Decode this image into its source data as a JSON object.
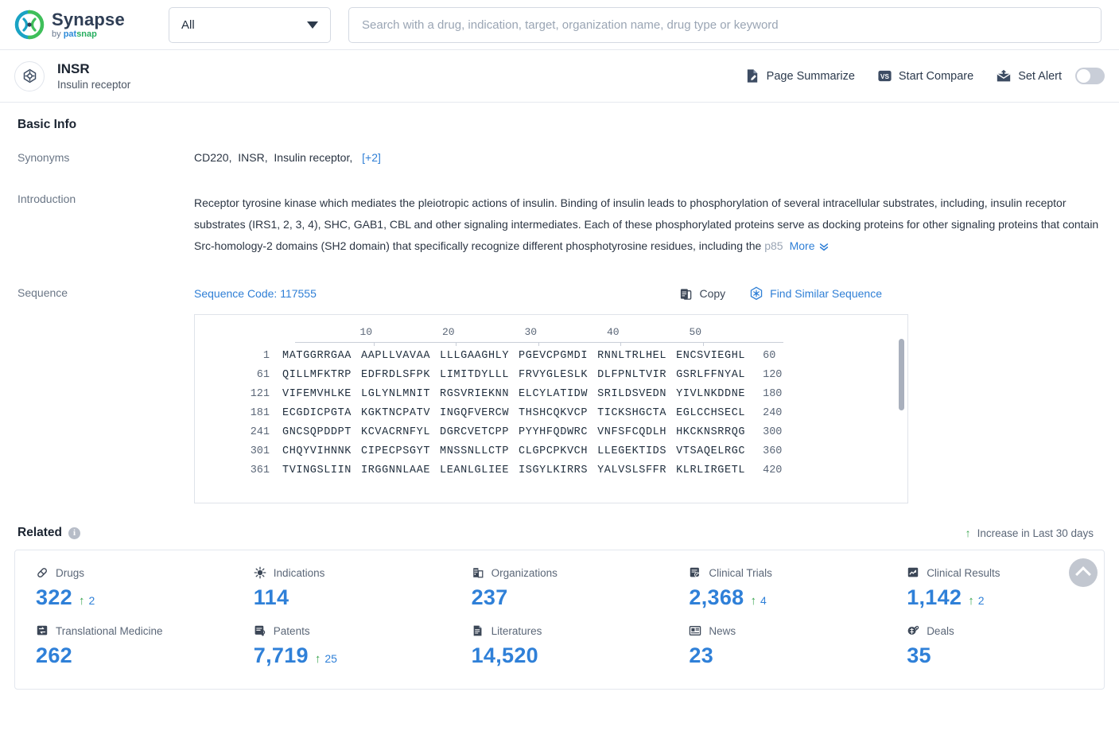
{
  "brand": {
    "name": "Synapse",
    "byline_prefix": "by ",
    "byline_pat": "pat",
    "byline_snap": "snap",
    "logo_icon": "synapse-logo-icon"
  },
  "search": {
    "scope_value": "All",
    "scope_caret_icon": "chevron-down-icon",
    "placeholder": "Search with a drug, indication, target, organization name, drug type or keyword",
    "value": ""
  },
  "entity": {
    "icon": "target-icon",
    "title": "INSR",
    "subtitle": "Insulin receptor",
    "actions": [
      {
        "label": "Page Summarize",
        "icon": "page-summarize-icon"
      },
      {
        "label": "Start Compare",
        "icon": "vs-compare-icon"
      },
      {
        "label": "Set Alert",
        "icon": "alert-mail-icon",
        "toggle": "off"
      }
    ]
  },
  "basic_info": {
    "section_title": "Basic Info",
    "synonyms_label": "Synonyms",
    "synonyms": [
      "CD220",
      "INSR",
      "Insulin receptor"
    ],
    "synonyms_more": "[+2]",
    "introduction_label": "Introduction",
    "introduction": "Receptor tyrosine kinase which mediates the pleiotropic actions of insulin. Binding of insulin leads to phosphorylation of several intracellular substrates, including, insulin receptor substrates (IRS1, 2, 3, 4), SHC, GAB1, CBL and other signaling intermediates. Each of these phosphorylated proteins serve as docking proteins for other signaling proteins that contain Src-homology-2 domains (SH2 domain) that specifically recognize different phosphotyrosine residues, including the ",
    "introduction_tail": "p85",
    "more_label": "More",
    "more_icon": "chevron-double-down-icon"
  },
  "sequence": {
    "label": "Sequence",
    "code_label": "Sequence Code: 117555",
    "copy_label": "Copy",
    "copy_icon": "copy-icon",
    "find_label": "Find Similar Sequence",
    "find_icon": "find-similar-icon",
    "ruler_ticks": [
      "10",
      "20",
      "30",
      "40",
      "50"
    ],
    "rows": [
      {
        "start": "1",
        "blocks": [
          "MATGGRRGAA",
          "AAPLLVAVAA",
          "LLLGAAGHLY",
          "PGEVCPGMDI",
          "RNNLTRLHEL",
          "ENCSVIEGHL"
        ],
        "end": "60"
      },
      {
        "start": "61",
        "blocks": [
          "QILLMFKTRP",
          "EDFRDLSFPK",
          "LIMITDYLLL",
          "FRVYGLESLK",
          "DLFPNLTVIR",
          "GSRLFFNYAL"
        ],
        "end": "120"
      },
      {
        "start": "121",
        "blocks": [
          "VIFEMVHLKE",
          "LGLYNLMNIT",
          "RGSVRIEKNN",
          "ELCYLATIDW",
          "SRILDSVEDN",
          "YIVLNKDDNE"
        ],
        "end": "180"
      },
      {
        "start": "181",
        "blocks": [
          "ECGDICPGTA",
          "KGKTNCPATV",
          "INGQFVERCW",
          "THSHCQKVCP",
          "TICKSHGCTA",
          "EGLCCHSECL"
        ],
        "end": "240"
      },
      {
        "start": "241",
        "blocks": [
          "GNCSQPDDPT",
          "KCVACRNFYL",
          "DGRCVETCPP",
          "PYYHFQDWRC",
          "VNFSFCQDLH",
          "HKCKNSRRQG"
        ],
        "end": "300"
      },
      {
        "start": "301",
        "blocks": [
          "CHQYVIHNNK",
          "CIPECPSGYT",
          "MNSSNLLCTP",
          "CLGPCPKVCH",
          "LLEGEKTIDS",
          "VTSAQELRGC"
        ],
        "end": "360"
      },
      {
        "start": "361",
        "blocks": [
          "TVINGSLIIN",
          "IRGGNNLAAE",
          "LEANLGLIEE",
          "ISGYLKIRRS",
          "YALVSLSFFR",
          "KLRLIRGETL"
        ],
        "end": "420"
      }
    ]
  },
  "related": {
    "title": "Related",
    "info_icon": "info-icon",
    "legend": "Increase in Last 30 days",
    "legend_icon": "up-arrow-icon",
    "items": [
      {
        "label": "Drugs",
        "icon": "capsule-icon",
        "value": "322",
        "delta": "2"
      },
      {
        "label": "Indications",
        "icon": "virus-icon",
        "value": "114",
        "delta": ""
      },
      {
        "label": "Organizations",
        "icon": "building-icon",
        "value": "237",
        "delta": ""
      },
      {
        "label": "Clinical Trials",
        "icon": "clinical-trial-icon",
        "value": "2,368",
        "delta": "4"
      },
      {
        "label": "Clinical Results",
        "icon": "clinical-result-icon",
        "value": "1,142",
        "delta": "2"
      },
      {
        "label": "Translational Medicine",
        "icon": "translational-icon",
        "value": "262",
        "delta": ""
      },
      {
        "label": "Patents",
        "icon": "patent-icon",
        "value": "7,719",
        "delta": "25"
      },
      {
        "label": "Literatures",
        "icon": "literature-icon",
        "value": "14,520",
        "delta": ""
      },
      {
        "label": "News",
        "icon": "news-icon",
        "value": "23",
        "delta": ""
      },
      {
        "label": "Deals",
        "icon": "deals-icon",
        "value": "35",
        "delta": ""
      }
    ]
  },
  "scroll_top": {
    "icon": "scroll-to-top-icon"
  },
  "colors": {
    "accent_blue": "#2f80d8",
    "link_blue": "#2f7fd6",
    "increase_green": "#3aa650"
  }
}
